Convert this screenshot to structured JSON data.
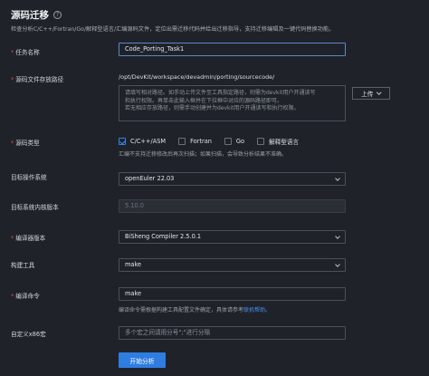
{
  "header": {
    "title": "源码迁移",
    "help_icon": "?",
    "description": "检查分析C/C++/Fortran/Go/解释型语言/汇编源码文件，定位出需迁移代码并给出迁移指导，支持迁移编辑及一键代码替换功能。"
  },
  "form": {
    "task_name": {
      "label": "任务名称",
      "required": true,
      "value": "Code_Porting_Task1"
    },
    "source_path": {
      "label": "源码文件存放路径",
      "required": true,
      "prefix": "/opt/DevKit/workspace/devadmin/porting/sourcecode/",
      "placeholder_lines": [
        "请填写相对路径。如手动上传文件至工具指定路径，则需为devkit用户开通读写",
        "和执行权限。再单击此输入框并在下拉框中对应的源码路径即可。",
        "若无相应存放路径，则需手动创建并为devkit用户开通读写和执行权限。"
      ],
      "upload_label": "上传"
    },
    "source_type": {
      "label": "源码类型",
      "required": true,
      "options": [
        {
          "label": "C/C++/ASM",
          "checked": true
        },
        {
          "label": "Fortran",
          "checked": false
        },
        {
          "label": "Go",
          "checked": false
        },
        {
          "label": "解释型语言",
          "checked": false
        }
      ],
      "hint": "汇编不支持迁移修改后再次扫描；如果扫描，会导致分析结果不准确。"
    },
    "target_os": {
      "label": "目标操作系统",
      "required": false,
      "value": "openEuler 22.03"
    },
    "kernel_version": {
      "label": "目标系统内核版本",
      "required": false,
      "value": "5.10.0"
    },
    "compiler_version": {
      "label": "编译器版本",
      "required": true,
      "value": "BiSheng Compiler 2.5.0.1"
    },
    "build_tool": {
      "label": "构建工具",
      "required": false,
      "value": "make"
    },
    "build_command": {
      "label": "编译命令",
      "required": true,
      "value": "make",
      "hint": "编译命令需根据构建工具配置文件确定，具体请参考",
      "hint_link": "联机帮助。"
    },
    "custom_macro": {
      "label": "自定义x86宏",
      "required": false,
      "placeholder": "多个宏之间请用分号\";\"进行分隔"
    },
    "submit_label": "开始分析"
  },
  "colors": {
    "accent": "#2f7de1",
    "required": "#e0463b",
    "link": "#4b8ef7",
    "background": "#1f2329"
  }
}
